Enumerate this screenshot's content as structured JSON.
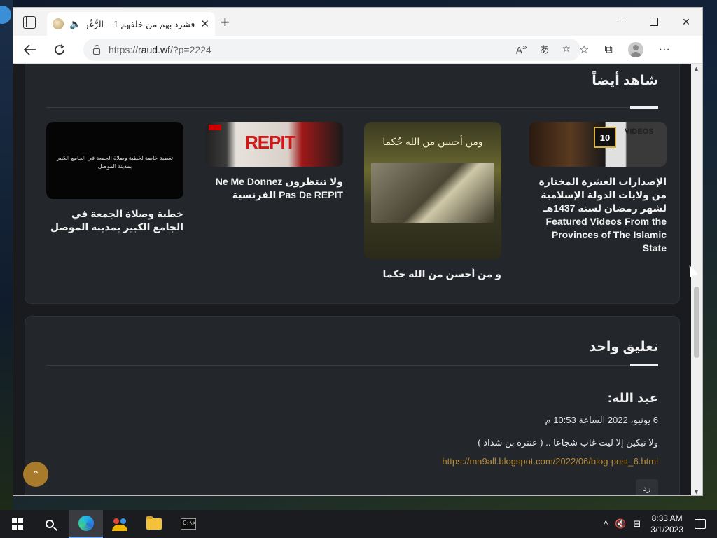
{
  "browser": {
    "tab": {
      "title": "فشرد بهم من خلفهم 1 – الرُّغُو",
      "audio_icon": "speaker-icon",
      "close_glyph": "✕"
    },
    "new_tab_glyph": "+",
    "window_controls": {
      "close_glyph": "✕"
    },
    "address": {
      "protocol": "https://",
      "url_main": "raud.wf",
      "url_rest": "/?p=2224"
    },
    "toolbar_icons": [
      "read-aloud-icon",
      "translate-icon",
      "add-favorite-icon",
      "favorites-icon",
      "collections-icon",
      "profile-icon",
      "more-icon"
    ],
    "more_glyph": "···"
  },
  "page": {
    "watch_section": {
      "title": "شاهد أيضاً",
      "items": [
        {
          "title": "الإصدارات العشرة المختارة من ولايات الدولة الإسلامية لشهر رمضان لسنة 1437هـ Featured Videos From the Provinces of The Islamic State",
          "thumb_badge": "10",
          "thumb_text": "VIDEOS"
        },
        {
          "title": "و من أحسن من الله حكما",
          "thumb_caption": "ومن أحسن من الله حُكما"
        },
        {
          "title": "ولا تنتظرون Ne Me Donnez Pas De REPIT الفرنسية",
          "thumb_text": "REPIT"
        },
        {
          "title": "خطبة وصلاة الجمعة في الجامع الكبير بمدينة الموصل",
          "thumb_text": "تغطية خاصة لخطبة وصلاة الجمعة في الجامع الكبير بمدينة الموصل"
        }
      ]
    },
    "comments_section": {
      "title": "تعليق واحد",
      "comment": {
        "author": "عبد الله:",
        "date": "6 يونيو، 2022 الساعة 10:53 م",
        "body": "ولا تبكين إلا ليث غاب شجاعا .. ( عنترة بن شداد )",
        "link": "https://ma9all.blogspot.com/2022/06/blog-post_6.html",
        "reply_label": "رد"
      }
    },
    "scroll_top_glyph": "⌃"
  },
  "taskbar": {
    "apps": [
      "start-icon",
      "search-icon",
      "edge-icon",
      "people-icon",
      "file-explorer-icon",
      "cmd-icon"
    ],
    "cmd_label": "C:\\>",
    "tray_chevron": "^",
    "clock": {
      "time": "8:33 AM",
      "date": "3/1/2023"
    }
  },
  "colors": {
    "page_bg": "#191b1e",
    "card_bg": "#23262a",
    "link": "#b58a3a",
    "accent": "#a77a2c"
  }
}
